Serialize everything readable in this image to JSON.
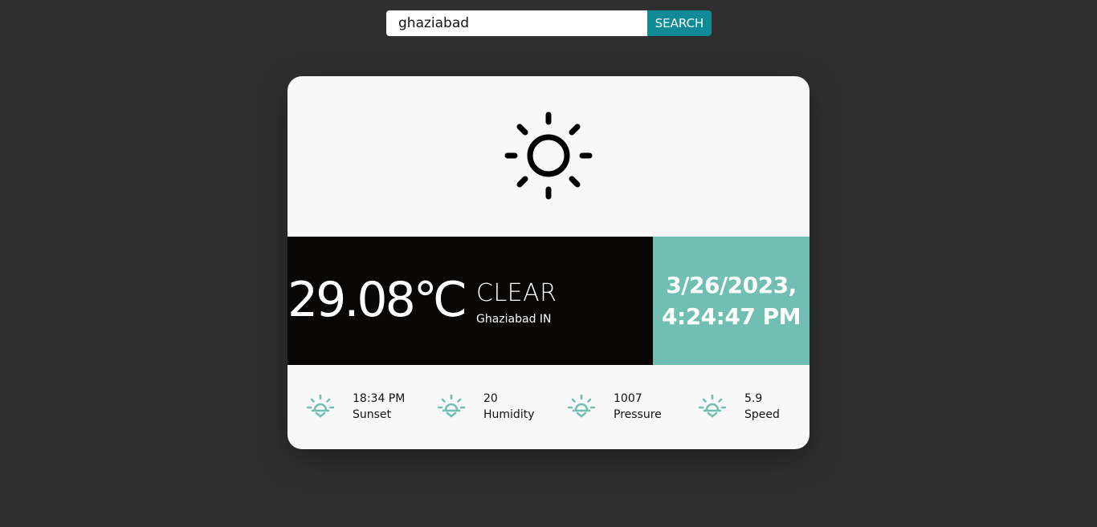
{
  "search": {
    "value": "ghaziabad",
    "button_label": "SEARCH"
  },
  "weather": {
    "icon": "sun-icon",
    "temperature": "29.08℃",
    "condition": "CLEAR",
    "location": "Ghaziabad IN",
    "date": "3/26/2023,",
    "time": "4:24:47 PM"
  },
  "stats": [
    {
      "icon": "sunset-icon",
      "value": "18:34 PM",
      "label": "Sunset"
    },
    {
      "icon": "sunset-icon",
      "value": "20",
      "label": "Humidity"
    },
    {
      "icon": "sunset-icon",
      "value": "1007",
      "label": "Pressure"
    },
    {
      "icon": "sunset-icon",
      "value": "5.9",
      "label": "Speed"
    }
  ],
  "colors": {
    "background": "#2f2f2f",
    "button": "#0f8a96",
    "accent": "#71bfb3",
    "dark_panel": "#080706",
    "card": "#f8f8f8"
  }
}
